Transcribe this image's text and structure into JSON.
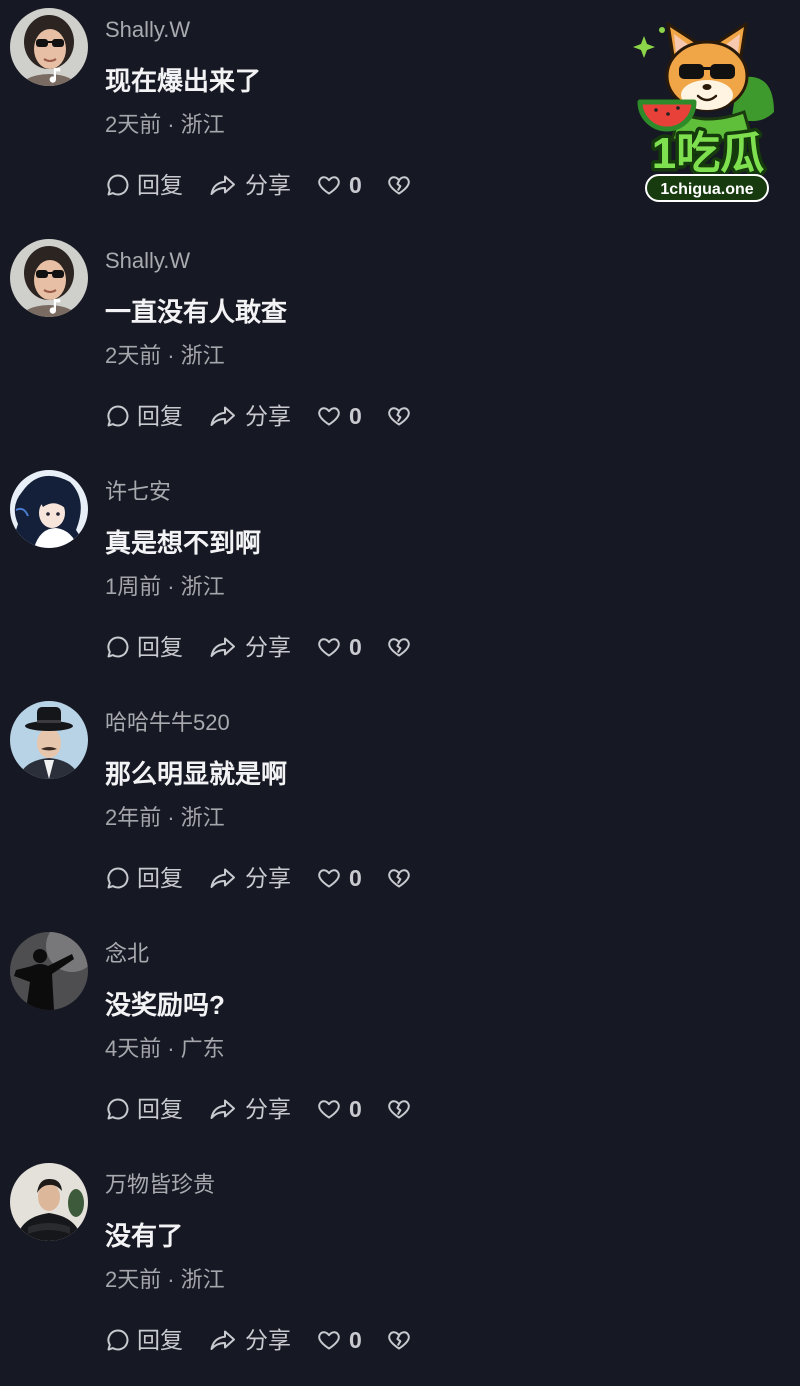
{
  "watermark": {
    "brand": "1吃瓜",
    "domain": "1chigua.one",
    "icon": "fox-sunglasses-watermelon-logo"
  },
  "meta_separator": "·",
  "actions": {
    "reply_label": "回复",
    "share_label": "分享",
    "reply_icon": "comment-bubble-icon",
    "share_icon": "share-arrow-icon",
    "like_icon": "heart-icon",
    "dislike_icon": "broken-heart-icon"
  },
  "theme": {
    "background": "#161823",
    "text_primary": "#f3f3f5",
    "text_secondary": "#a9aaaf",
    "action_text": "#c9cacf",
    "logo_green": "#7ee04f",
    "logo_orange": "#f0a547"
  },
  "comments": [
    {
      "username": "Shally.W",
      "text": "现在爆出来了",
      "time": "2天前",
      "location": "浙江",
      "likes": "0",
      "avatar": "avatar-woman-sunglasses"
    },
    {
      "username": "Shally.W",
      "text": "一直没有人敢查",
      "time": "2天前",
      "location": "浙江",
      "likes": "0",
      "avatar": "avatar-woman-sunglasses"
    },
    {
      "username": "许七安",
      "text": "真是想不到啊",
      "time": "1周前",
      "location": "浙江",
      "likes": "0",
      "avatar": "avatar-anime-girl"
    },
    {
      "username": "哈哈牛牛520",
      "text": "那么明显就是啊",
      "time": "2年前",
      "location": "浙江",
      "likes": "0",
      "avatar": "avatar-man-hat"
    },
    {
      "username": "念北",
      "text": "没奖励吗?",
      "time": "4天前",
      "location": "广东",
      "likes": "0",
      "avatar": "avatar-silhouette"
    },
    {
      "username": "万物皆珍贵",
      "text": "没有了",
      "time": "2天前",
      "location": "浙江",
      "likes": "0",
      "avatar": "avatar-man-black-shirt"
    }
  ]
}
